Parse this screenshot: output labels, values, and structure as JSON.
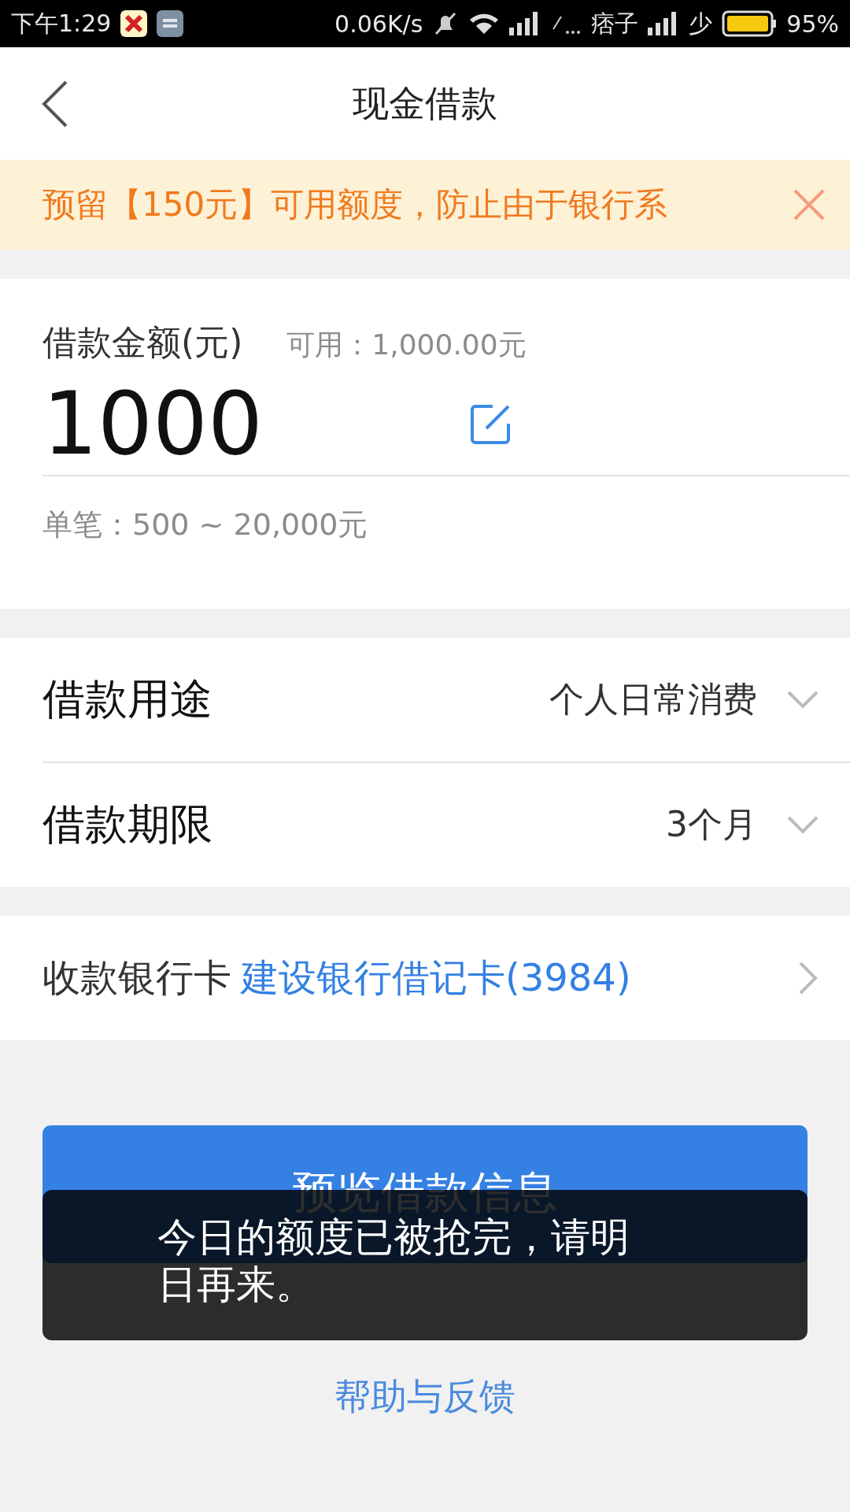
{
  "status_bar": {
    "time": "下午1:29",
    "net_speed": "0.06K/s",
    "carrier": "痞子",
    "sim_label": "少",
    "battery": "95%"
  },
  "header": {
    "title": "现金借款"
  },
  "notice": {
    "text": "预留【150元】可用额度，防止由于银行系"
  },
  "amount": {
    "label": "借款金额(元)",
    "available": "可用：1,000.00元",
    "value": "1000",
    "range": "单笔：500 ~ 20,000元"
  },
  "options": [
    {
      "label": "借款用途",
      "value": "个人日常消费"
    },
    {
      "label": "借款期限",
      "value": "3个月"
    }
  ],
  "bank": {
    "label": "收款银行卡",
    "value": "建设银行借记卡(3984)"
  },
  "submit_button": "预览借款信息",
  "toast": "今日的额度已被抢完，请明日再来。",
  "help_link": "帮助与反馈"
}
